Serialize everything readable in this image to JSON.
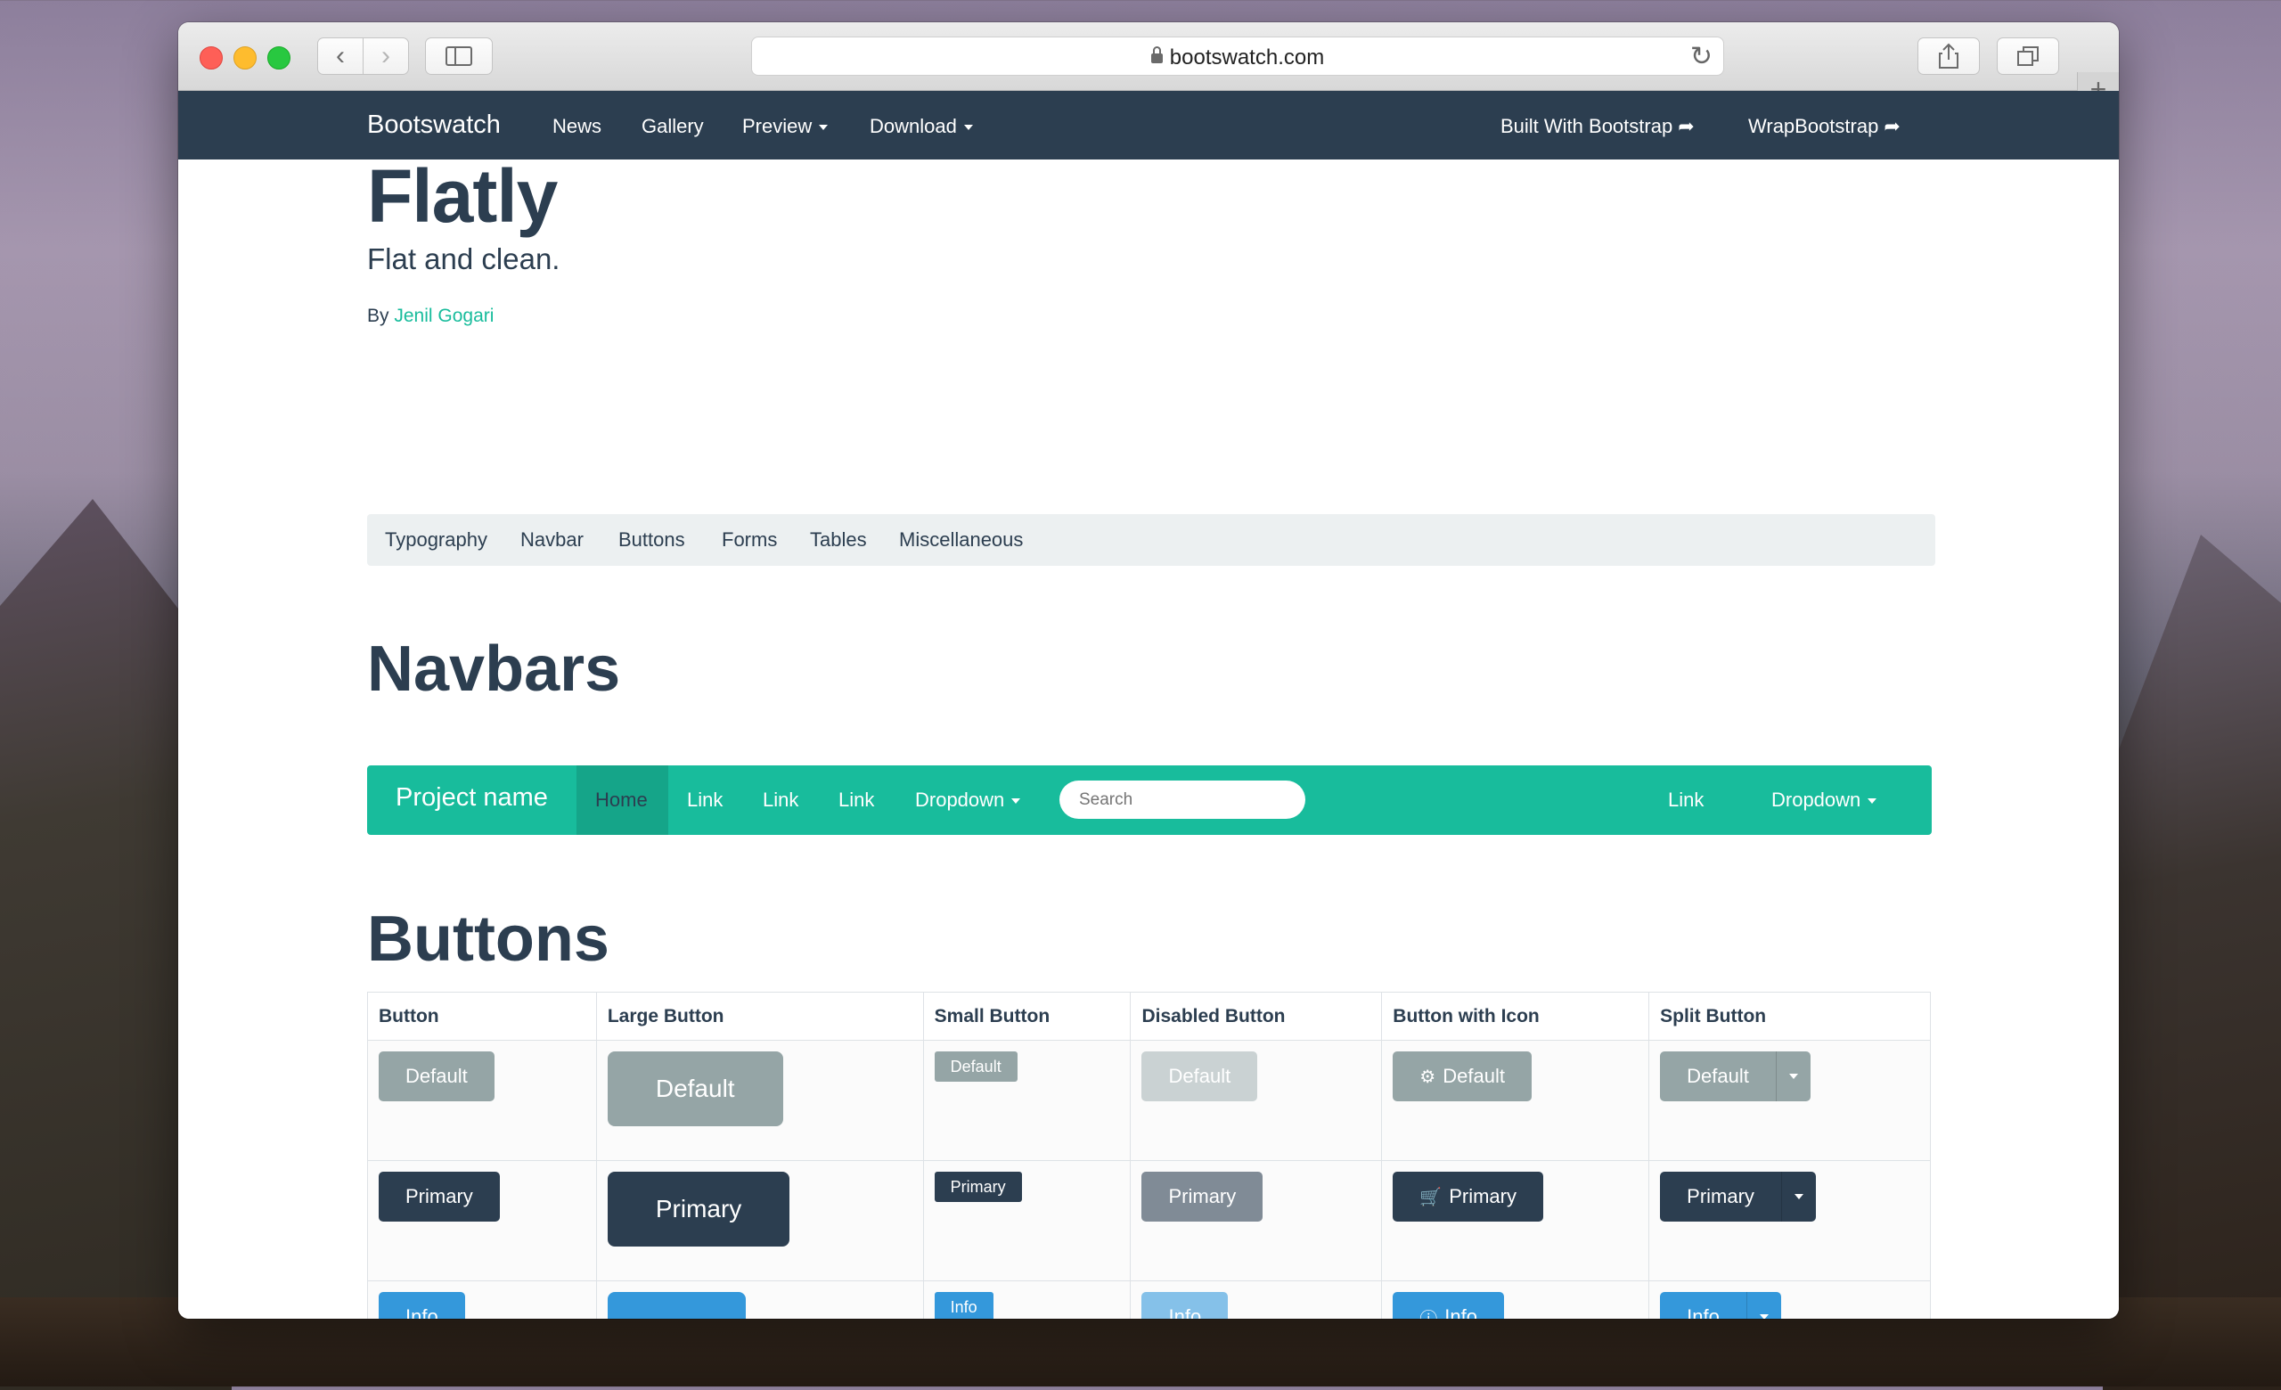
{
  "browser": {
    "url": "bootswatch.com",
    "new_tab_label": "+"
  },
  "site_nav": {
    "brand": "Bootswatch",
    "items": [
      "News",
      "Gallery",
      "Preview",
      "Download"
    ],
    "right_items": [
      "Built With Bootstrap",
      "WrapBootstrap"
    ]
  },
  "header": {
    "title": "Flatly",
    "lead": "Flat and clean.",
    "by_prefix": "By",
    "author": "Jenil Gogari"
  },
  "subnav": {
    "items": [
      "Typography",
      "Navbar",
      "Buttons",
      "Forms",
      "Tables",
      "Miscellaneous"
    ]
  },
  "sections": {
    "navbars": "Navbars",
    "buttons": "Buttons"
  },
  "demo_navbar": {
    "brand": "Project name",
    "items": [
      "Home",
      "Link",
      "Link",
      "Link",
      "Dropdown"
    ],
    "search_placeholder": "Search",
    "right_items": [
      "Link",
      "Dropdown"
    ],
    "color": "#18bc9c"
  },
  "buttons_table": {
    "headers": [
      "Button",
      "Large Button",
      "Small Button",
      "Disabled Button",
      "Button with Icon",
      "Split Button"
    ],
    "rows": [
      {
        "label": "Default",
        "color": "#95a5a6",
        "icon": "gear-icon"
      },
      {
        "label": "Primary",
        "color": "#2c3e50",
        "icon": "cart-icon"
      },
      {
        "label": "Info",
        "color": "#3498db",
        "icon": "info-circle-icon"
      }
    ]
  },
  "colors": {
    "primary": "#2c3e50",
    "success": "#18bc9c",
    "info": "#3498db",
    "default": "#95a5a6"
  }
}
